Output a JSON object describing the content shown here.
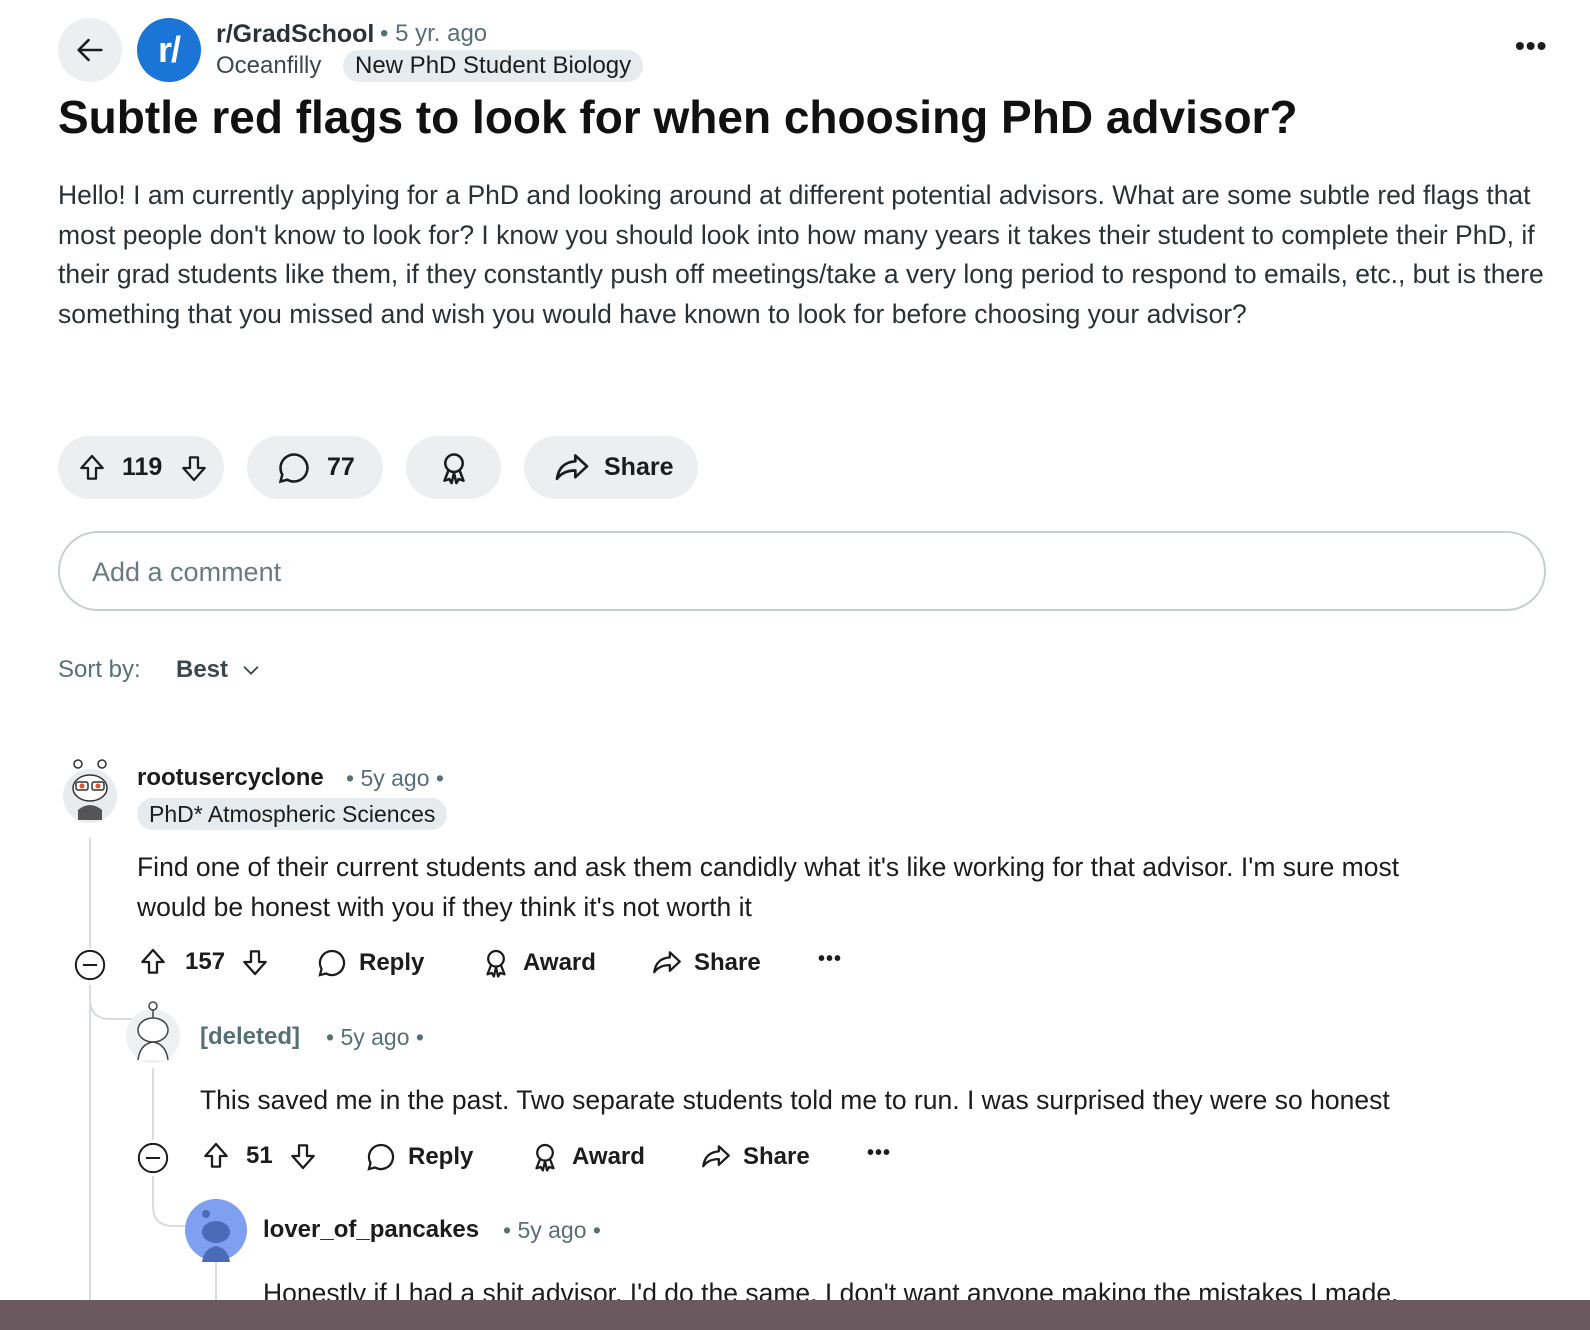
{
  "post": {
    "subreddit": "r/GradSchool",
    "subreddit_icon_text": "r/",
    "time": "• 5 yr. ago",
    "author": "Oceanfilly",
    "author_flair": "New PhD Student Biology",
    "title": "Subtle red flags to look for when choosing PhD advisor?",
    "body": "Hello! I am currently applying for a PhD and looking around at different potential advisors. What are some subtle red flags that most people don't know to look for? I know you should look into how many years it takes their student to complete their PhD, if their grad students like them, if they constantly push off meetings/take a very long period to respond to emails, etc., but is there something that you missed and wish you would have known to look for before choosing your advisor?",
    "score": "119",
    "comments": "77",
    "share_label": "Share",
    "more": "•••"
  },
  "comment_input": {
    "placeholder": "Add a comment"
  },
  "sort": {
    "label": "Sort by:",
    "value": "Best"
  },
  "comments": [
    {
      "user": "rootusercyclone",
      "meta": "• 5y ago •",
      "flair": "PhD* Atmospheric Sciences",
      "text_line1": "Find one of their current students and ask them candidly what it's like working for that advisor. I'm sure most",
      "text_line2": "would be honest with you if they think it's not worth it",
      "score": "157",
      "reply": "Reply",
      "award": "Award",
      "share": "Share",
      "more": "•••"
    },
    {
      "user": "[deleted]",
      "meta": "• 5y ago •",
      "text": "This saved me in the past. Two separate students told me to run. I was surprised they were so honest",
      "score": "51",
      "reply": "Reply",
      "award": "Award",
      "share": "Share",
      "more": "•••"
    },
    {
      "user": "lover_of_pancakes",
      "meta": "• 5y ago •",
      "text": "Honestly if I had a shit advisor, I'd do the same. I don't want anyone making the mistakes I made."
    }
  ],
  "colors": {
    "subreddit_blue": "#1a75d6",
    "pill_bg": "#eceef0",
    "flair_bg": "#e5ebee",
    "avatar3": "#7f9ff0"
  }
}
